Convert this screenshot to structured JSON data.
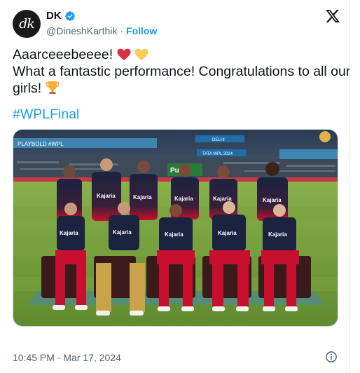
{
  "author": {
    "avatar_text": "dk",
    "name": "DK",
    "handle": "@DineshKarthik",
    "separator": "·",
    "follow_label": "Follow"
  },
  "tweet": {
    "line1": "Aaarceeebeeee!",
    "line2": "What a fantastic performance! Congratulations to all our",
    "line3": "girls!",
    "hashtag": "#WPLFinal"
  },
  "media": {
    "description_icons": [
      "team-photo"
    ],
    "sponsor_text": "Kajaria",
    "banner_left": "PLAYBOLD #WPL",
    "banner_center_top": "DELHI",
    "banner_center": "TATA WPL 2024",
    "board_text": "Pu"
  },
  "meta": {
    "timestamp": "10:45 PM · Mar 17, 2024"
  },
  "colors": {
    "accent": "#1d9bf0",
    "jersey_dark": "#1c2340",
    "jersey_red": "#c8102e",
    "grass": "#6f9a3a"
  },
  "icons": {
    "verified": "verified-badge-icon",
    "x_logo": "x-logo-icon",
    "info": "info-icon"
  }
}
